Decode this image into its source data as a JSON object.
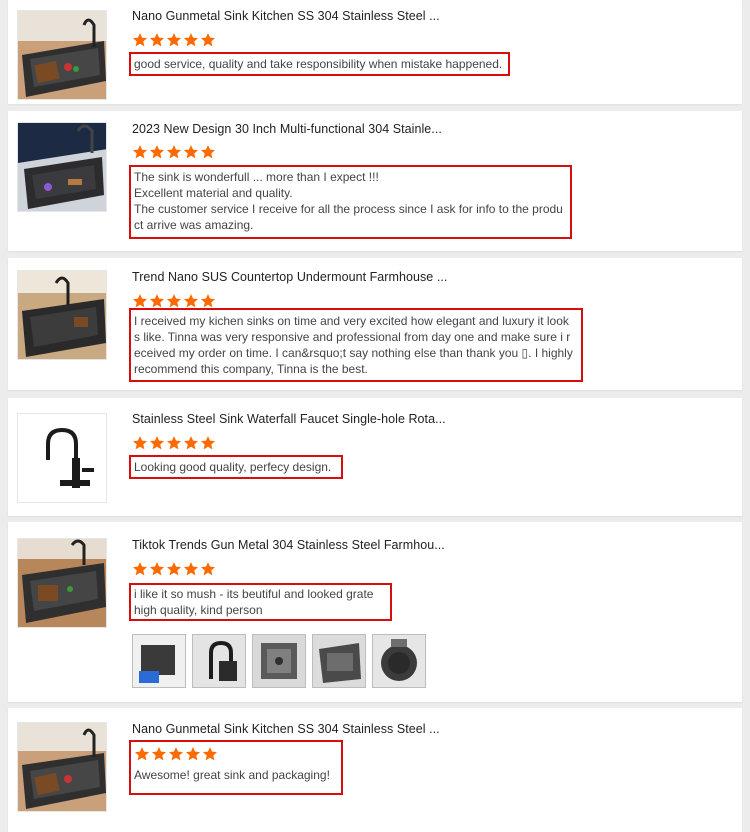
{
  "reviews": [
    {
      "title": "Nano Gunmetal Sink Kitchen SS 304 Stainless Steel ...",
      "rating": 5,
      "lines": [
        "good service, quality and take responsibility when mistake happened."
      ]
    },
    {
      "title": "2023 New Design 30 Inch Multi-functional 304 Stainle...",
      "rating": 5,
      "lines": [
        "The sink is wonderfull ... more than I expect !!!",
        "Excellent material and quality.",
        "The customer service I receive for all the process since I ask for info to the produ",
        "ct arrive  was amazing."
      ]
    },
    {
      "title": "Trend Nano SUS Countertop Undermount Farmhouse ...",
      "rating": 5,
      "lines": [
        "I received my kichen sinks on time and very excited how elegant and luxury it look",
        "s like. Tinna was very responsive and professional from day one and make sure i r",
        "eceived my order on time. I can&rsquo;t say nothing else than thank you ▯. I highly",
        "recommend this company, Tinna is the best."
      ]
    },
    {
      "title": "Stainless Steel Sink Waterfall Faucet Single-hole Rota...",
      "rating": 5,
      "lines": [
        "Looking good quality, perfecy design."
      ]
    },
    {
      "title": "Tiktok Trends Gun Metal 304 Stainless Steel Farmhou...",
      "rating": 5,
      "lines": [
        "i like it so mush - its beutiful and looked grate",
        "high quality, kind person"
      ]
    },
    {
      "title": "Nano Gunmetal Sink Kitchen SS 304 Stainless Steel ...",
      "rating": 5,
      "lines": [
        "Awesome! great sink and packaging!"
      ]
    }
  ],
  "colors": {
    "star": "#ff6a00",
    "highlight_border": "#d80d0d",
    "page_bg": "#ececec"
  },
  "icons": {
    "star": "star-icon"
  }
}
